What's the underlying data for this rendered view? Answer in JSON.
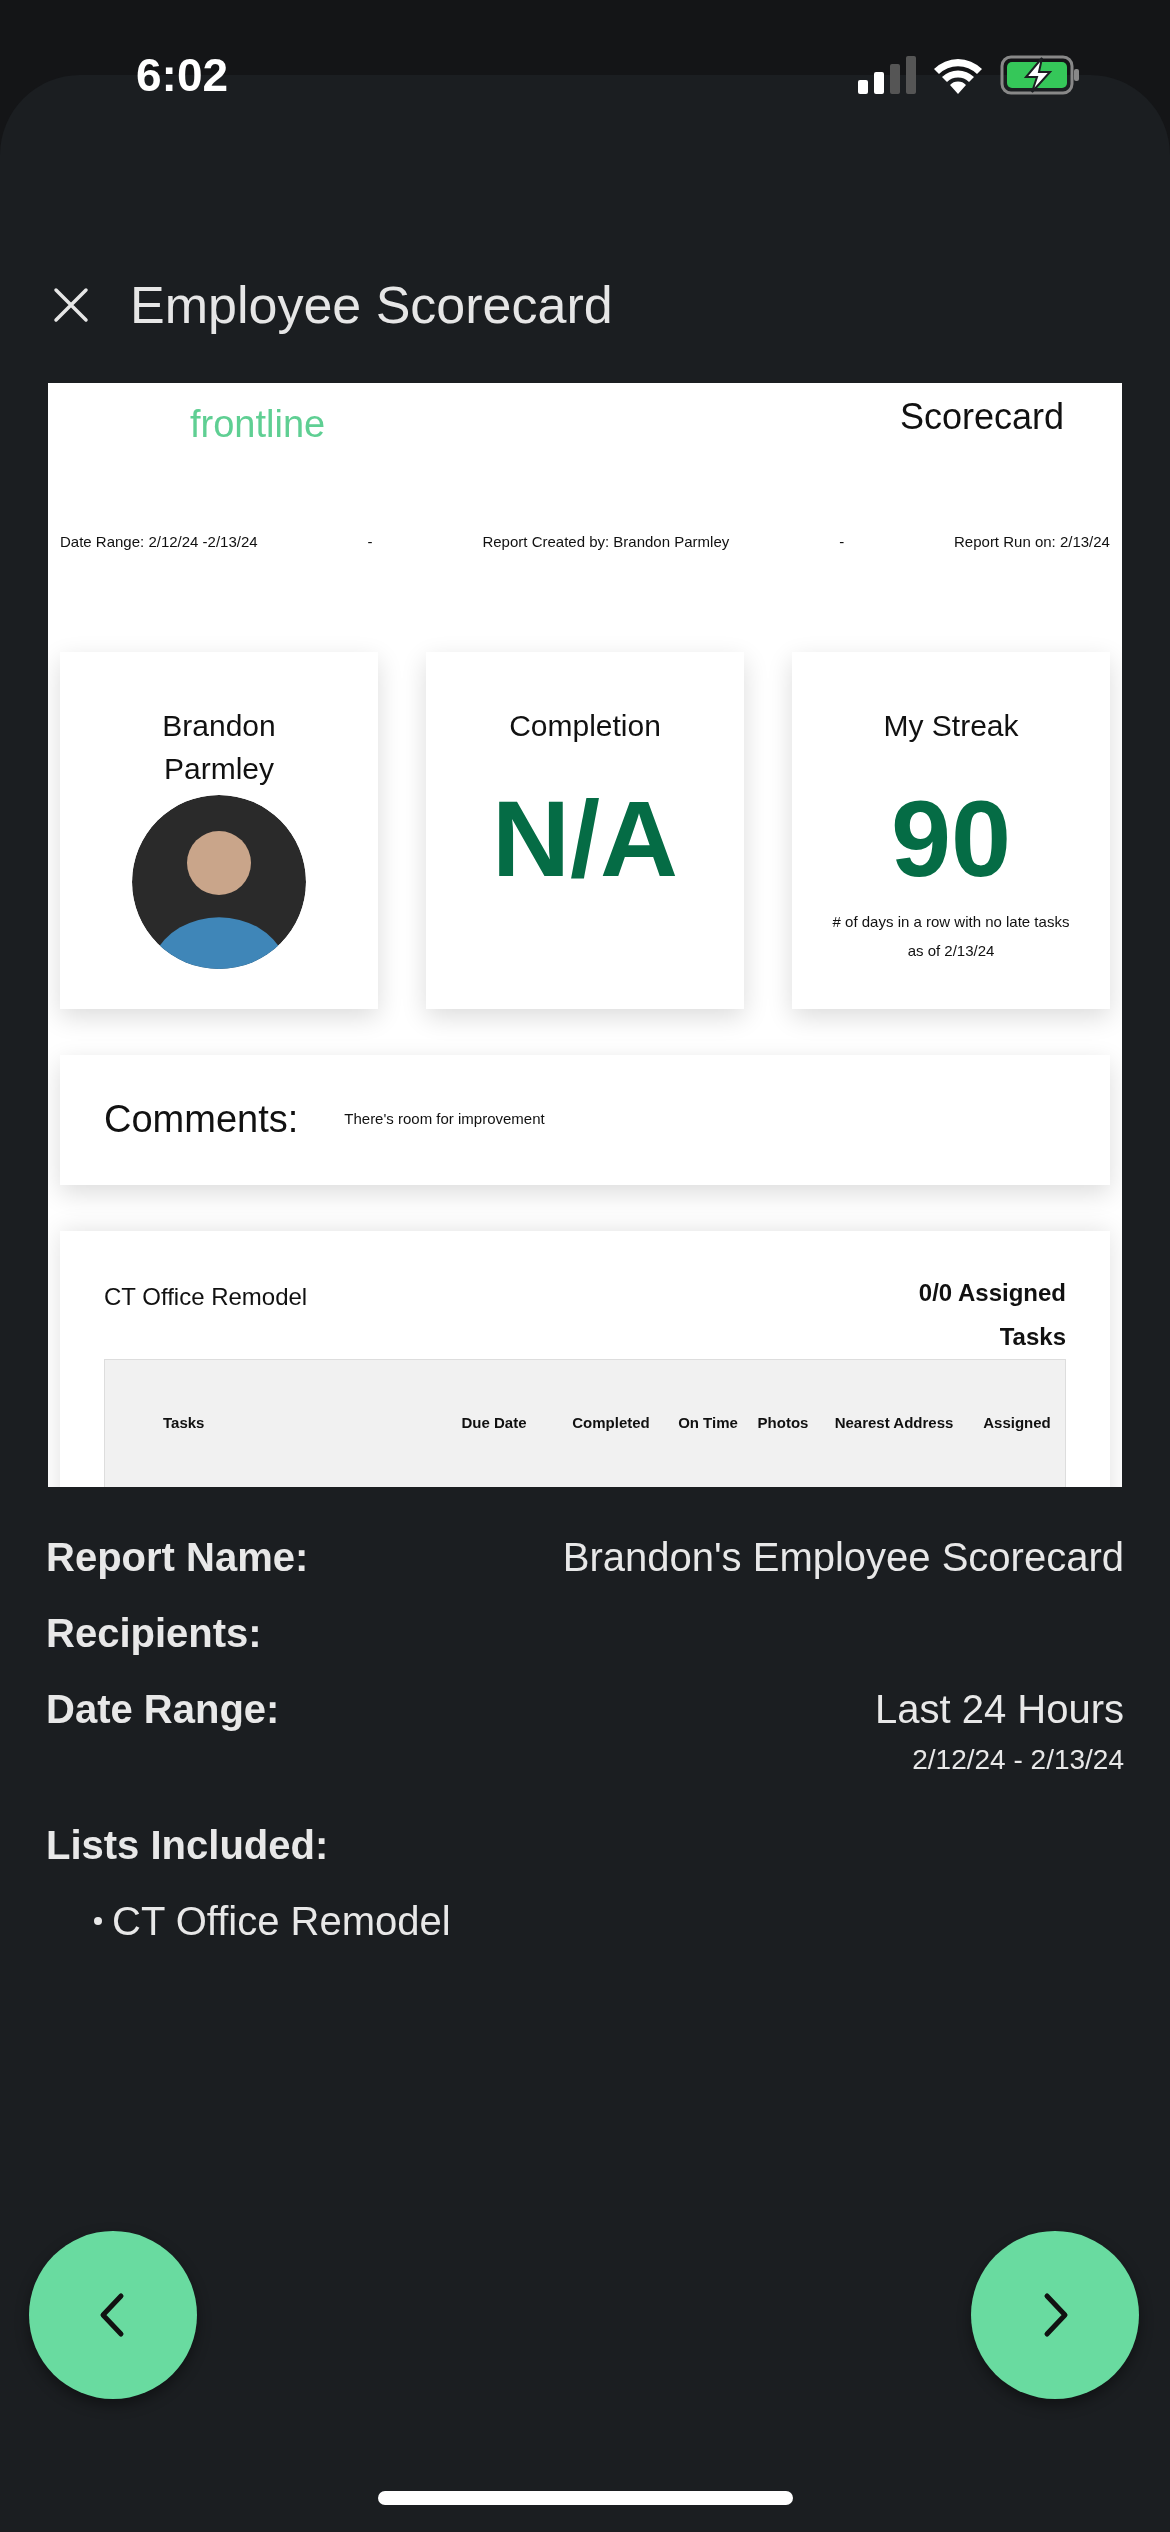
{
  "status_bar": {
    "time": "6:02"
  },
  "header": {
    "title": "Employee Scorecard"
  },
  "report_preview": {
    "brand": "frontline",
    "heading": "Scorecard",
    "meta": [
      "Date Range: 2/12/24 -2/13/24",
      "-",
      "Report Created by: Brandon Parmley",
      "-",
      "Report Run on: 2/13/24"
    ],
    "cards": [
      {
        "kind": "profile",
        "title": "Brandon Parmley"
      },
      {
        "kind": "metric",
        "title": "Completion",
        "value": "N/A"
      },
      {
        "kind": "metric",
        "title": "My Streak",
        "value": "90",
        "caption": "# of days in a row with no late tasks as of 2/13/24"
      }
    ],
    "comments": {
      "label": "Comments:",
      "text": "There's room for improvement"
    },
    "task_list": {
      "name": "CT Office Remodel",
      "summary": "0/0 Assigned Tasks",
      "columns": [
        "Tasks",
        "Due Date",
        "Completed",
        "On Time",
        "Photos",
        "Nearest Address",
        "Assigned"
      ]
    }
  },
  "details": [
    {
      "label": "Report Name:",
      "value": "Brandon's Employee Scorecard"
    },
    {
      "label": "Recipients:"
    },
    {
      "label": "Date Range:",
      "value": "Last 24 Hours",
      "subvalue": "2/12/24 - 2/13/24"
    }
  ],
  "lists_included": {
    "label": "Lists Included:",
    "items": [
      "CT Office Remodel"
    ]
  }
}
